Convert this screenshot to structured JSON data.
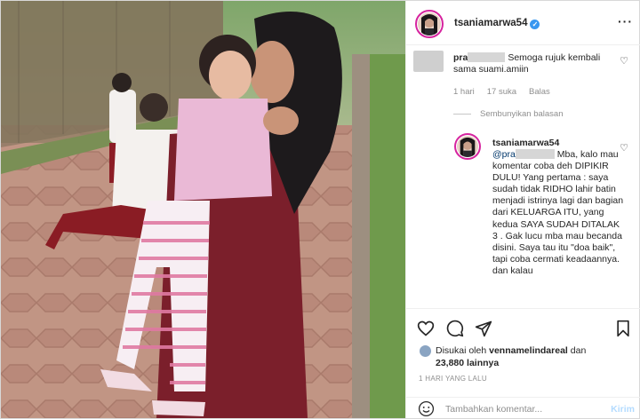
{
  "post": {
    "username": "tsaniamarwa54",
    "verified_icon": "verified-badge-icon",
    "more_icon": "ellipsis-icon"
  },
  "comments": [
    {
      "username_prefix": "pra",
      "text": "Semoga rujuk kembali sama suami.amiin",
      "time": "1 hari",
      "likes": "17 suka",
      "reply_label": "Balas"
    }
  ],
  "hide_replies_label": "Sembunyikan balasan",
  "reply": {
    "username": "tsaniamarwa54",
    "mention_prefix": "@pra",
    "text": "Mba, kalo mau komentar coba deh DIPIKIR DULU! Yang pertama : saya sudah tidak RIDHO lahir batin menjadi istrinya lagi dan bagian dari KELUARGA ITU, yang kedua SAYA SUDAH DITALAK 3 . Gak lucu mba mau becanda disini. Saya tau itu \"doa baik\", tapi coba cermati keadaannya. dan kalau"
  },
  "likes": {
    "prefix": "Disukai oleh",
    "user": "vennamelindareal",
    "connector": "dan",
    "count": "23,880 lainnya"
  },
  "timestamp": "1 HARI YANG LALU",
  "add_comment": {
    "placeholder": "Tambahkan komentar...",
    "post_label": "Kirim"
  },
  "colors": {
    "accent": "#3897f0",
    "story_ring": "#d6249f",
    "post_disabled": "#b3dbff"
  }
}
